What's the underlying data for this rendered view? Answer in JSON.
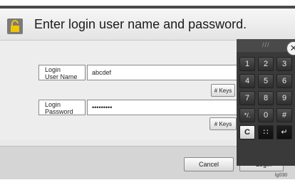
{
  "header": {
    "title": "Enter login user name and password."
  },
  "fields": {
    "username": {
      "label_line1": "Login",
      "label_line2": "User Name",
      "value": "abcdef",
      "keys_label": "# Keys"
    },
    "password": {
      "label_line1": "Login",
      "label_line2": "Password",
      "value": "•••••••••",
      "keys_label": "# Keys"
    }
  },
  "footer": {
    "cancel_label": "Cancel",
    "login_label": "Login"
  },
  "keypad": {
    "keys": [
      "1",
      "2",
      "3",
      "4",
      "5",
      "6",
      "7",
      "8",
      "9",
      "*/.",
      "0",
      "#",
      "C",
      "∷",
      "↵"
    ],
    "close": "✕",
    "grip": "///"
  },
  "caption": "lg030"
}
